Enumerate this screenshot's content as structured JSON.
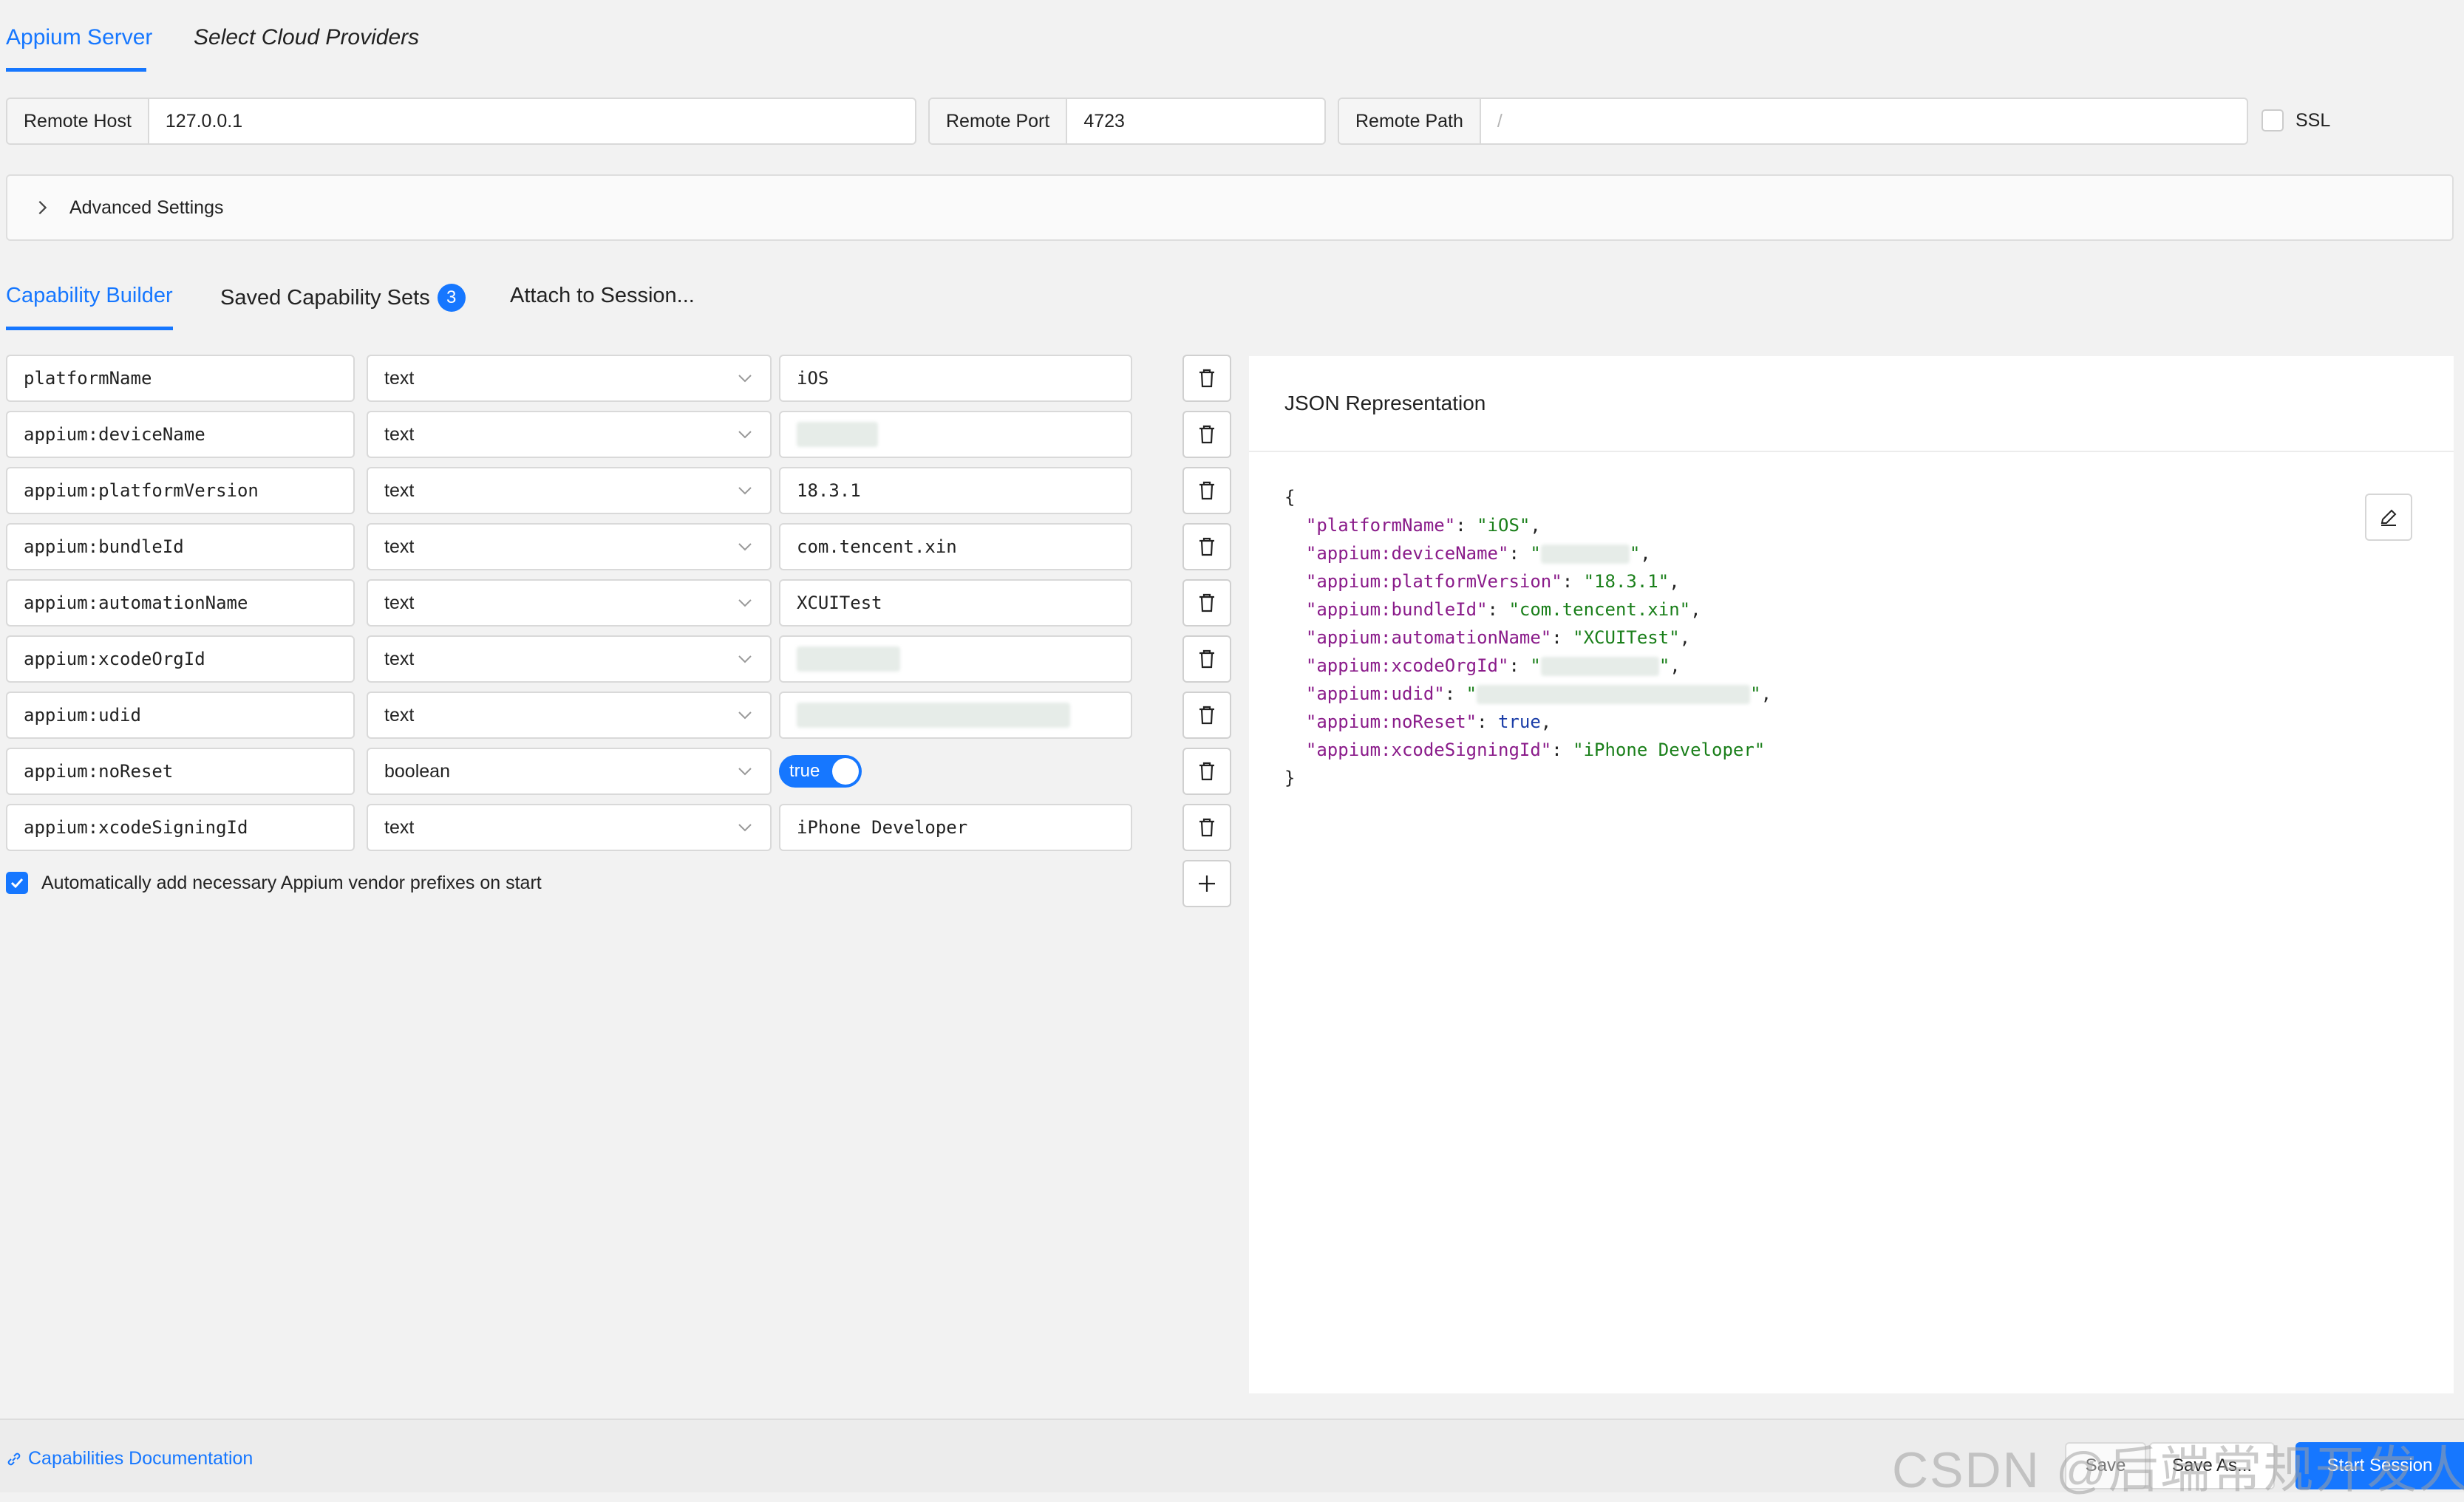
{
  "top_tabs": {
    "server": "Appium Server",
    "cloud": "Select Cloud Providers"
  },
  "remote": {
    "host_label": "Remote Host",
    "host_value": "127.0.0.1",
    "port_label": "Remote Port",
    "port_value": "4723",
    "path_label": "Remote Path",
    "path_placeholder": "/",
    "ssl_label": "SSL"
  },
  "advanced_label": "Advanced Settings",
  "cap_tabs": {
    "builder": "Capability Builder",
    "saved": "Saved Capability Sets",
    "saved_count": "3",
    "attach": "Attach to Session..."
  },
  "caps": [
    {
      "name": "platformName",
      "type": "text",
      "value": "iOS"
    },
    {
      "name": "appium:deviceName",
      "type": "text",
      "value": ""
    },
    {
      "name": "appium:platformVersion",
      "type": "text",
      "value": "18.3.1"
    },
    {
      "name": "appium:bundleId",
      "type": "text",
      "value": "com.tencent.xin"
    },
    {
      "name": "appium:automationName",
      "type": "text",
      "value": "XCUITest"
    },
    {
      "name": "appium:xcodeOrgId",
      "type": "text",
      "value": ""
    },
    {
      "name": "appium:udid",
      "type": "text",
      "value": ""
    },
    {
      "name": "appium:noReset",
      "type": "boolean",
      "value": "true"
    },
    {
      "name": "appium:xcodeSigningId",
      "type": "text",
      "value": "iPhone Developer"
    }
  ],
  "prefix_label": "Automatically add necessary Appium vendor prefixes on start",
  "json_title": "JSON Representation",
  "json_lines": {
    "open": "{",
    "close": "}",
    "true_literal": "true"
  },
  "footer": {
    "docs": "Capabilities Documentation",
    "watermark": "CSDN @后端常规开发人员",
    "save": "Save",
    "save_as": "Save As...",
    "start": "Start Session"
  },
  "colors": {
    "accent": "#1677ff",
    "json_key": "#8a1b8a",
    "json_string": "#1a7f1a"
  },
  "icons": [
    "chevron-right-icon",
    "chevron-down-icon",
    "trash-icon",
    "plus-icon",
    "edit-icon",
    "link-icon",
    "check-icon"
  ]
}
